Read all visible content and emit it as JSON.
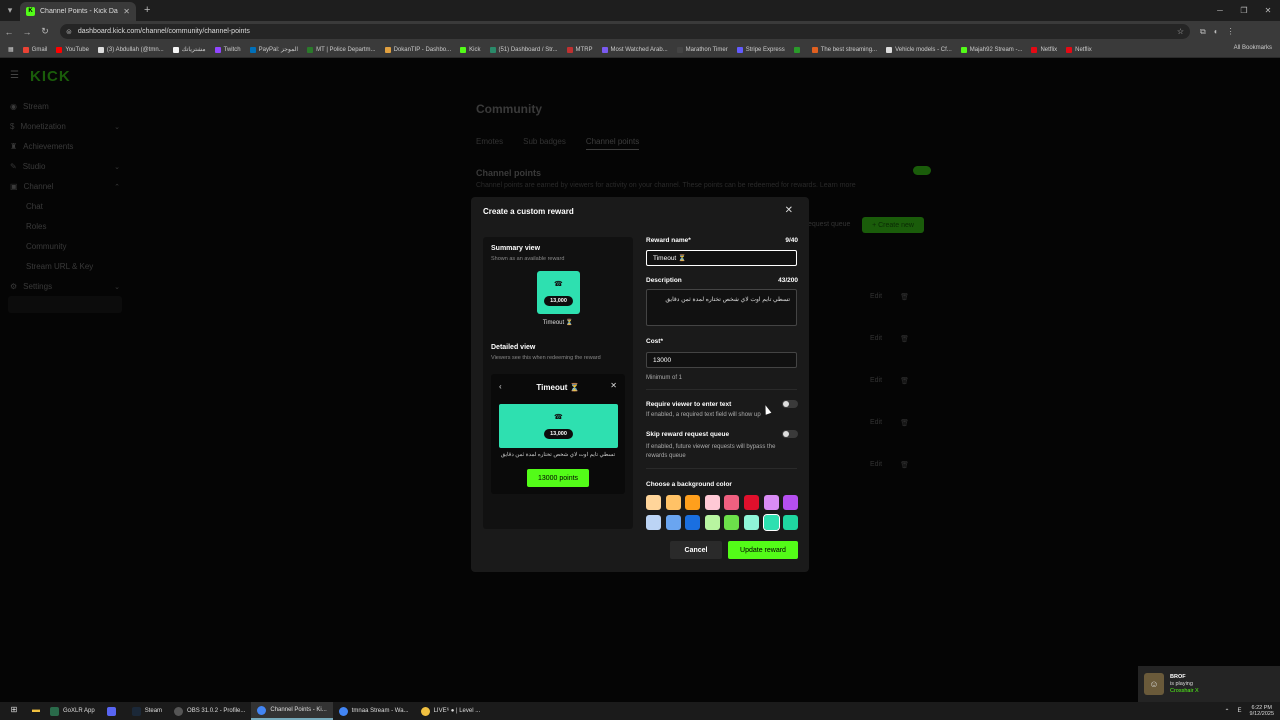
{
  "browser": {
    "tab_title": "Channel Points - Kick Dashboo...",
    "url": "dashboard.kick.com/channel/community/channel-points",
    "bookmarks": [
      "Gmail",
      "YouTube",
      "(3) Abdullah (@tmn...",
      "مشترياتك",
      "Twitch",
      "PayPal: الموجز",
      "MT | Police Departm...",
      "DokanTIP - Dashbo...",
      "Kick",
      "(51) Dashboard / Str...",
      "MTRP",
      "Most Watched Arab...",
      "Marathon Timer",
      "Stripe Express",
      "",
      "The best streaming...",
      "Vehicle models - Cf...",
      "Majah92 Stream -...",
      "Netflix",
      "Netflix"
    ],
    "all_bookmarks": "All Bookmarks"
  },
  "sidebar": {
    "logo": "KICK",
    "items": [
      {
        "label": "Stream"
      },
      {
        "label": "Monetization"
      },
      {
        "label": "Achievements"
      },
      {
        "label": "Studio"
      },
      {
        "label": "Channel"
      },
      {
        "label": "Chat"
      },
      {
        "label": "Roles"
      },
      {
        "label": "Community"
      },
      {
        "label": "Stream URL & Key"
      },
      {
        "label": "Settings"
      }
    ]
  },
  "page": {
    "title": "Community",
    "tabs": [
      "Emotes",
      "Sub badges",
      "Channel points"
    ],
    "section_title": "Channel points",
    "section_desc": "Channel points are earned by viewers for activity on your channel. These points can be redeemed for rewards.",
    "learn_more": "Learn more",
    "request_queue": "equest queue",
    "create_new": "+ Create new",
    "edit": "Edit"
  },
  "modal": {
    "title": "Create a custom reward",
    "summary_title": "Summary view",
    "summary_sub": "Shown as an available reward",
    "detailed_title": "Detailed view",
    "detailed_sub": "Viewers see this when redeeming the reward",
    "reward_cost_short": "13,000",
    "reward_name_display": "Timeout ⏳",
    "detail_button": "13000 points",
    "reward_name_label": "Reward name*",
    "reward_name_count": "9/40",
    "reward_name_value": "Timeout ⏳",
    "description_label": "Description",
    "description_count": "43/200",
    "description_value": "تسطي تايم اوت لاي شخص تختاره لمدة ثمن دقايق",
    "cost_label": "Cost*",
    "cost_value": "13000",
    "cost_hint": "Minimum of 1",
    "require_text_label": "Require viewer to enter text",
    "require_text_hint": "If enabled, a required text field will show up",
    "skip_queue_label": "Skip reward request queue",
    "skip_queue_hint": "If enabled, future viewer requests will bypass the rewards queue",
    "color_label": "Choose a background color",
    "colors": [
      "#ffd59a",
      "#ffc266",
      "#ff9f1c",
      "#ffc9d6",
      "#f06080",
      "#e0102c",
      "#d98cf5",
      "#b54ff0",
      "#bcd4f5",
      "#6aa5f0",
      "#1a6fe0",
      "#b8f5a0",
      "#6ce04a",
      "#8ff5d8",
      "#2ee0b0",
      "#1fd6a0"
    ],
    "selected_color": "#2ee0b0",
    "cancel": "Cancel",
    "update": "Update reward"
  },
  "notification": {
    "name": "BROF",
    "status": "is playing",
    "game": "Crosshair X"
  },
  "taskbar": {
    "apps": [
      "GoXLR App",
      "",
      "Steam",
      "OBS 31.0.2 - Profile...",
      "Channel Points - Ki...",
      "tmnaa Stream - Wa...",
      "LIVE⁶ ● | Level ..."
    ],
    "time": "6:22 PM",
    "date": "9/12/2025"
  }
}
